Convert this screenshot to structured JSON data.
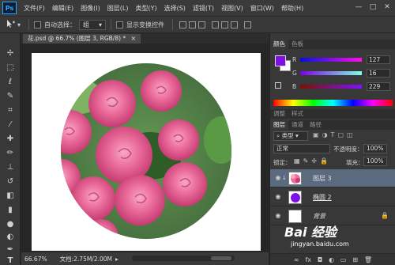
{
  "app": {
    "logo": "Ps"
  },
  "menu": [
    "文件(F)",
    "编辑(E)",
    "图像(I)",
    "图层(L)",
    "类型(Y)",
    "选择(S)",
    "滤镜(T)",
    "视图(V)",
    "窗口(W)",
    "帮助(H)"
  ],
  "window_controls": {
    "minimize": "—",
    "restore": "□",
    "close": "✕"
  },
  "options": {
    "auto_select_label": "自动选择：",
    "auto_select_value": "组",
    "show_transform_label": "显示变换控件"
  },
  "document": {
    "tab_title": "花.psd @ 66.7% (图层 3, RGB/8) *",
    "tab_close": "×"
  },
  "status": {
    "zoom": "66.67%",
    "doc_info": "文档:2.75M/2.00M"
  },
  "color_panel": {
    "tabs": [
      "颜色",
      "色板"
    ],
    "r_label": "R",
    "g_label": "G",
    "b_label": "B",
    "r_value": "127",
    "g_value": "16",
    "b_value": "229",
    "fg_color": "#7f10e5",
    "bg_color": "#ffffff"
  },
  "panel_tabs_2": [
    "图层",
    "通道",
    "路径"
  ],
  "adjust_tabs": [
    "调整",
    "样式"
  ],
  "layers_panel": {
    "kind_label": "类型",
    "blend_mode": "正常",
    "opacity_label": "不透明度：",
    "opacity_value": "100%",
    "lock_label": "锁定：",
    "fill_label": "填充：",
    "fill_value": "100%",
    "layers": [
      {
        "name": "图层 3",
        "selected": true
      },
      {
        "name": "椭圆 2",
        "selected": false
      },
      {
        "name": "背景",
        "selected": false
      }
    ],
    "bottom_icons": [
      "link-icon",
      "fx-icon",
      "mask-icon",
      "adjustment-icon",
      "folder-icon",
      "new-layer-icon",
      "trash-icon"
    ]
  },
  "watermark": {
    "text": "Bai 经验",
    "url": "jingyan.baidu.com"
  }
}
